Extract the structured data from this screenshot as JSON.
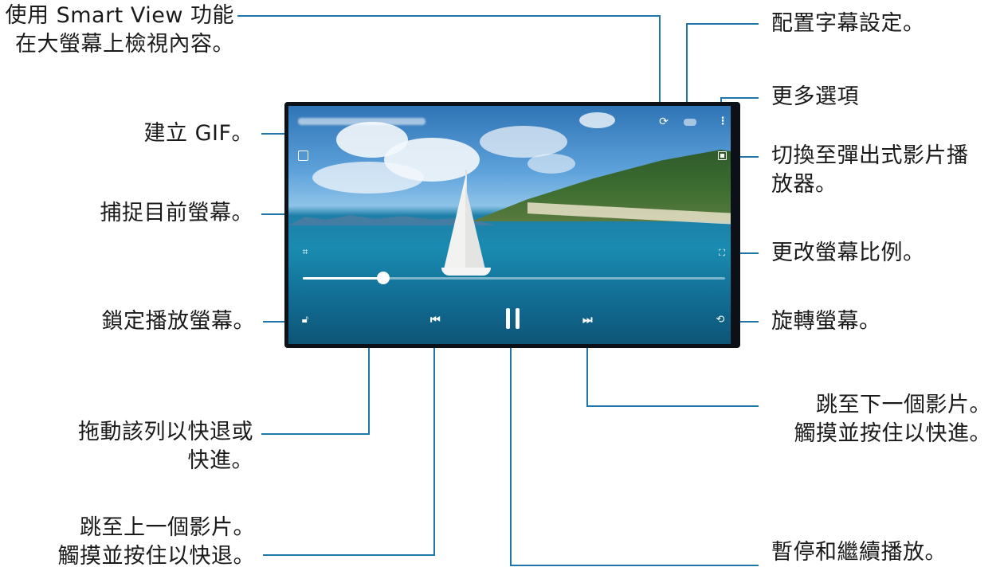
{
  "callouts": {
    "smart_view": [
      "使用 Smart View 功能",
      "在大螢幕上檢視內容。"
    ],
    "subtitle_settings": [
      "配置字幕設定。"
    ],
    "more_options": [
      "更多選項"
    ],
    "create_gif": [
      "建立 GIF。"
    ],
    "popup_player": [
      "切換至彈出式影片播",
      "放器。"
    ],
    "capture_screen": [
      "捕捉目前螢幕。"
    ],
    "screen_ratio": [
      "更改螢幕比例。"
    ],
    "lock_screen": [
      "鎖定播放螢幕。"
    ],
    "rotate_screen": [
      "旋轉螢幕。"
    ],
    "drag_bar": [
      "拖動該列以快退或",
      "快進。"
    ],
    "next_video": [
      "跳至下一個影片。",
      "觸摸並按住以快進。"
    ],
    "prev_video": [
      "跳至上一個影片。",
      "觸摸並按住以快退。"
    ],
    "pause_resume": [
      "暫停和繼續播放。"
    ]
  },
  "player": {
    "progress": 0.19,
    "icons": {
      "smart_view": "smart-view-icon",
      "subtitle": "subtitle-icon",
      "more": "more-options-icon",
      "gif": "gif-icon",
      "popup": "popup-player-icon",
      "capture": "capture-icon",
      "ratio": "screen-ratio-icon",
      "lock": "lock-icon",
      "prev": "previous-icon",
      "pause": "pause-icon",
      "next": "next-icon",
      "rotate": "rotate-icon"
    }
  },
  "colors": {
    "leader": "#1f77a8",
    "text": "#1a1a1a"
  }
}
